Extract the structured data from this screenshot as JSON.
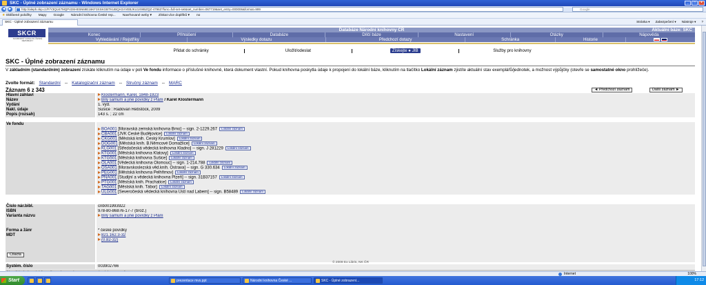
{
  "browser": {
    "window_title": "SKC - Úplné zobrazení záznamu - Windows Internet Explorer",
    "url": "http://aleph.nkp.cz/F/Y3QU47MQP43SHE5N69E16KF3XSKGBTKUBQH1VVEBJKU1X9IBZQZ-47963?func=full-set-set&set_number=067719&set_entry=000006&format=999",
    "search_placeholder": "Google",
    "favorites": [
      {
        "label": "Oblíbené položky"
      },
      {
        "label": "Mapy"
      },
      {
        "label": "Google"
      },
      {
        "label": "Národní knihovna České rep..."
      },
      {
        "label": "Navrhované weby ▾"
      },
      {
        "label": "Získat více doplňků ▾"
      },
      {
        "label": "no"
      }
    ],
    "tab_title": "SKC - Úplné zobrazení záznamu",
    "tools": [
      "Stránka ▾",
      "Zabezpečení ▾",
      "Nástroje ▾",
      "?"
    ],
    "status_url": "",
    "zone": "Internet",
    "zoom": "100%"
  },
  "site": {
    "logo_text": "SKCR",
    "logo_sub": "SOUBORNÝ KATALOG ČESKÉ REPUBLIKY",
    "band_title": "Databáze Národní knihovny ČR",
    "current_db": "Aktuální báze: SKC",
    "menu_row1": [
      "Konec",
      "Přihlášení",
      "Databáze",
      "Dílčí báze",
      "Nastavení",
      "Otázky",
      "Nápověda"
    ],
    "menu_row2": [
      "Vyhledávání / Rejstříky",
      "Výsledky dotazu",
      "Předchozí dotazy",
      "Schránka",
      "Historie"
    ],
    "actions": [
      "Přidat do schránky",
      "Uložit/odeslat",
      "Získejte",
      "JIB",
      "Služby pro knihovny"
    ]
  },
  "page": {
    "title": "SKC - Úplné zobrazení záznamu",
    "intro_1": "V ",
    "intro_b1": "základním (standardním) zobrazení",
    "intro_2": " získáte kliknutím na údaje v poli ",
    "intro_b2": "Ve fondu",
    "intro_3": " informace o příslušné knihovně, která dokument vlastní. Pokud knihovna poskytla údaje k propojení do lokální báze, kliknutím na tlačítko ",
    "intro_b3": "Lokální záznam",
    "intro_4": " zjistíte aktuální stav exemplářů/jednotek, a možnost výpůjčky (otevře se ",
    "intro_b4": "samostatné okno",
    "intro_5": " prohlížeče).",
    "formats_label": "Zvolte formát:",
    "formats": [
      "Standardní",
      "Katalogizační záznam",
      "Stručný záznam",
      "MARC"
    ],
    "formats_sep": "--",
    "record_count": "Záznam 6 z 343",
    "prev_label": "◄ Předchozí záznam",
    "next_label": "Další záznam ►",
    "local_btn": "Lokální záznam",
    "fields": {
      "hlavni_k": "Hlavní záhlaví",
      "hlavni_v": "Klostermann, Karel, 1848-1923",
      "nazev_k": "Název",
      "nazev_v1": "Bílý samum a jiné povídky z Plání",
      "nazev_v2": " / Karel Klostermann",
      "vydani_k": "Vydání",
      "vydani_v": "1. vyd.",
      "nakl_k": "Nakl. údaje",
      "nakl_v": "Sušice : Radovan Rebstöck, 2009",
      "popis_k": "Popis (rozsah)",
      "popis_v": "143 s. ; 22 cm",
      "fond_k": "Ve fondu",
      "cnb_k": "Číslo nár.bibl.",
      "cnb_v": "cnb001993922",
      "isbn_k": "ISBN",
      "isbn_v": "978-80-86876-17-7 (brož.)",
      "var_k": "Varianta názvu",
      "var_v": "Bílý samum a jiné povídky z Plání",
      "forma_k": "Forma a žánr",
      "forma_v": "* české povídky",
      "mdt_k": "MDT",
      "mdt_v1": "821.162.3-32",
      "mdt_v2": "(0.82-32)",
      "sys_k": "Systém. číslo",
      "sys_v": "003902766"
    },
    "holdings": [
      {
        "sigla": "BOA001",
        "text": " [Moravská zemská knihovna Brno] -- sign. 2-1229.267"
      },
      {
        "sigla": "CBA001",
        "text": " [JVK České Budějovice]"
      },
      {
        "sigla": "CKG001",
        "text": " [Městská knih. Český Krumlov]"
      },
      {
        "sigla": "DOG001",
        "text": " [Městská knih. B.Němcové Domažlice]"
      },
      {
        "sigla": "KLG001",
        "text": " [Středočeská vědecká knihovna Kladno] -- sign. J 281229"
      },
      {
        "sigla": "KTG001",
        "text": " [Městská knihovna Klatovy]"
      },
      {
        "sigla": "KTG501",
        "text": " [Městská knihovna Sušice]"
      },
      {
        "sigla": "OLA001",
        "text": " [Vědecká knihovna Olomouc] -- sign. 1-214.788"
      },
      {
        "sigla": "OSA001",
        "text": " [Moravskoslezská věd.knih. Ostrava] -- sign. G 330.634"
      },
      {
        "sigla": "PEG001",
        "text": " [Městská knihovna Pelhřimov]"
      },
      {
        "sigla": "PNA001",
        "text": " [Studijní a vědecká knihovna Plzeň] -- sign. 31B37157"
      },
      {
        "sigla": "PTG001",
        "text": " [Městská knih. Prachatice]"
      },
      {
        "sigla": "TAG001",
        "text": " [Městská knih. Tábor]"
      },
      {
        "sigla": "ULG001",
        "text": " [Severočeská vědecká knihovna Ústí nad Labem] -- sign. B58489"
      }
    ],
    "permalink": "[ http://aleph.nkp.cz/F/?func=direct&doc_number=003902766&local_base=SKC ]",
    "back_label": "Ctlacta",
    "copyright": "© 2009 Ex Libris, NK ČR"
  },
  "taskbar": {
    "start": "Start",
    "tasks": [
      "",
      "",
      "",
      "prezentace mvs.ppt",
      "Národní knihovna České ...",
      "SKC - Úplné zobrazení..."
    ],
    "clock": "17:12"
  }
}
